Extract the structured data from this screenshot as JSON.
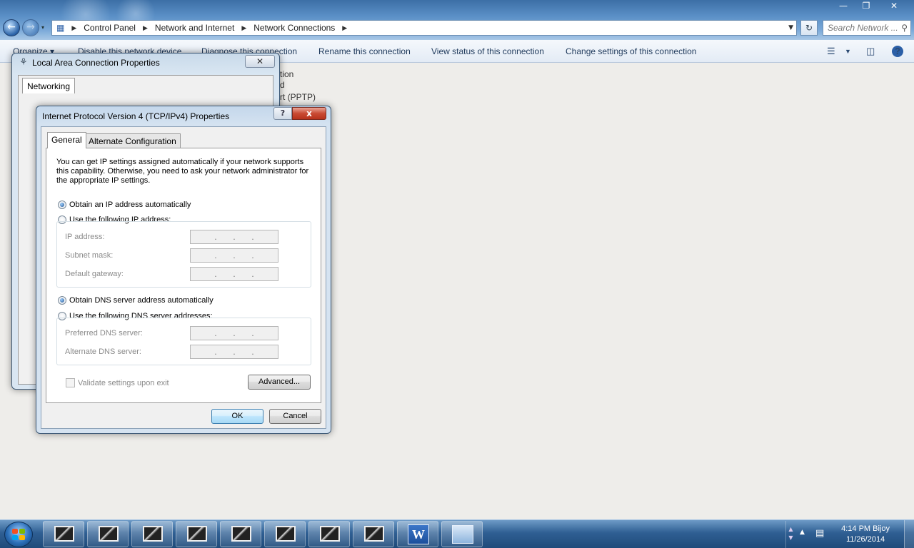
{
  "explorer": {
    "breadcrumb": [
      "Control Panel",
      "Network and Internet",
      "Network Connections"
    ],
    "search_placeholder": "Search Network ...",
    "toolbar": {
      "organize": "Organize ▾",
      "disable": "Disable this network device",
      "diagnose": "Diagnose this connection",
      "rename": "Rename this connection",
      "view_status": "View status of this connection",
      "change_settings": "Change settings of this connection"
    },
    "bg_fragments": [
      "tion",
      "d",
      "rt (PPTP)"
    ]
  },
  "lan_dialog": {
    "title": "Local Area Connection Properties",
    "tab": "Networking"
  },
  "ipv4_dialog": {
    "title": "Internet Protocol Version 4 (TCP/IPv4) Properties",
    "help": "?",
    "close": "x",
    "tabs": {
      "general": "General",
      "alternate": "Alternate Configuration"
    },
    "description": "You can get IP settings assigned automatically if your network supports this capability. Otherwise, you need to ask your network administrator for the appropriate IP settings.",
    "radio_auto_ip": "Obtain an IP address automatically",
    "radio_manual_ip": "Use the following IP address:",
    "ip_address_label": "IP address:",
    "subnet_label": "Subnet mask:",
    "gateway_label": "Default gateway:",
    "radio_auto_dns": "Obtain DNS server address automatically",
    "radio_manual_dns": "Use the following DNS server addresses:",
    "preferred_dns_label": "Preferred DNS server:",
    "alternate_dns_label": "Alternate DNS server:",
    "validate_label": "Validate settings upon exit",
    "advanced": "Advanced...",
    "ok": "OK",
    "cancel": "Cancel",
    "selected": {
      "ip": "auto",
      "dns": "auto"
    }
  },
  "taskbar": {
    "clock_line1": "4:14 PM Bijoy",
    "clock_line2": "11/26/2014",
    "word_glyph": "W"
  }
}
